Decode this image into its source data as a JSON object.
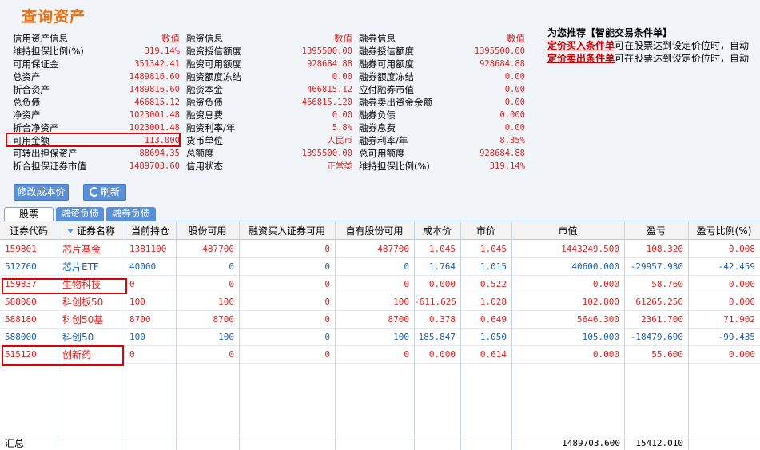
{
  "title": "查询资产",
  "info": {
    "col1": [
      {
        "label": "信用资产信息",
        "value": "数值",
        "head": true
      },
      {
        "label": "维持担保比例(%)",
        "value": "319.14%"
      },
      {
        "label": "可用保证金",
        "value": "351342.41"
      },
      {
        "label": "总资产",
        "value": "1489816.60"
      },
      {
        "label": "折合资产",
        "value": "1489816.60"
      },
      {
        "label": "总负债",
        "value": "466815.12"
      },
      {
        "label": "净资产",
        "value": "1023001.48"
      },
      {
        "label": "折合净资产",
        "value": "1023001.48"
      },
      {
        "label": "可用金额",
        "value": "113.000"
      },
      {
        "label": "可转出担保资产",
        "value": "88694.35"
      },
      {
        "label": "折合担保证券市值",
        "value": "1489703.60"
      }
    ],
    "col2": [
      {
        "label": "融资信息",
        "value": "数值",
        "head": true
      },
      {
        "label": "融资授信额度",
        "value": "1395500.00"
      },
      {
        "label": "融资可用额度",
        "value": "928684.88"
      },
      {
        "label": "融资额度冻结",
        "value": "0.00"
      },
      {
        "label": "融资本金",
        "value": "466815.12"
      },
      {
        "label": "融资负债",
        "value": "466815.120"
      },
      {
        "label": "融资息费",
        "value": "0.00"
      },
      {
        "label": "融资利率/年",
        "value": "5.8%"
      },
      {
        "label": "货币单位",
        "value": "人民币"
      },
      {
        "label": "总额度",
        "value": "1395500.00"
      },
      {
        "label": "信用状态",
        "value": "正常类"
      }
    ],
    "col3": [
      {
        "label": "融券信息",
        "value": "数值",
        "head": true
      },
      {
        "label": "融券授信额度",
        "value": "1395500.00"
      },
      {
        "label": "融券可用额度",
        "value": "928684.88"
      },
      {
        "label": "融券额度冻结",
        "value": "0.00"
      },
      {
        "label": "应付融券市值",
        "value": "0.00"
      },
      {
        "label": "融券卖出资金余额",
        "value": "0.00"
      },
      {
        "label": "融券负债",
        "value": "0.000"
      },
      {
        "label": "融券息费",
        "value": "0.00"
      },
      {
        "label": "融券利率/年",
        "value": "8.35%"
      },
      {
        "label": "总可用额度",
        "value": "928684.88"
      },
      {
        "label": "维持担保比例(%)",
        "value": "319.14%"
      }
    ]
  },
  "promo": {
    "title": "为您推荐【智能交易条件单】",
    "buy_link": "定价买入条件单",
    "buy_text": "可在股票达到设定价位时，自动",
    "sell_link": "定价卖出条件单",
    "sell_text": "可在股票达到设定价位时，自动"
  },
  "buttons": {
    "modify": "修改成本价",
    "refresh": "刷新"
  },
  "tabs": [
    "股票",
    "融资负债",
    "融券负债"
  ],
  "table": {
    "headers": [
      "证券代码",
      "证券名称",
      "当前持仓",
      "股份可用",
      "融资买入证券可用",
      "自有股份可用",
      "成本价",
      "市价",
      "市值",
      "盈亏",
      "盈亏比例(%)"
    ],
    "rows": [
      {
        "color": "red",
        "cells": [
          "159801",
          "芯片基金",
          "1381100",
          "487700",
          "0",
          "487700",
          "1.045",
          "1.045",
          "1443249.500",
          "108.320",
          "0.008"
        ]
      },
      {
        "color": "blue",
        "cells": [
          "512760",
          "芯片ETF",
          "40000",
          "0",
          "0",
          "0",
          "1.764",
          "1.015",
          "40600.000",
          "-29957.930",
          "-42.459"
        ]
      },
      {
        "color": "red",
        "cells": [
          "159837",
          "生物科技",
          "0",
          "0",
          "0",
          "0",
          "0.000",
          "0.522",
          "0.000",
          "58.760",
          "0.000"
        ]
      },
      {
        "color": "red",
        "cells": [
          "588080",
          "科创板50",
          "100",
          "100",
          "0",
          "100",
          "-611.625",
          "1.028",
          "102.800",
          "61265.250",
          "0.000"
        ]
      },
      {
        "color": "red",
        "cells": [
          "588180",
          "科创50基",
          "8700",
          "8700",
          "0",
          "8700",
          "0.378",
          "0.649",
          "5646.300",
          "2361.700",
          "71.902"
        ]
      },
      {
        "color": "blue",
        "cells": [
          "588000",
          "科创50",
          "100",
          "100",
          "0",
          "100",
          "185.847",
          "1.050",
          "105.000",
          "-18479.690",
          "-99.435"
        ]
      },
      {
        "color": "red",
        "cells": [
          "515120",
          "创新药",
          "0",
          "0",
          "0",
          "0",
          "0.000",
          "0.614",
          "0.000",
          "55.600",
          "0.000"
        ]
      }
    ],
    "summary": {
      "label": "汇总",
      "market_value": "1489703.600",
      "profit": "15412.010"
    }
  }
}
